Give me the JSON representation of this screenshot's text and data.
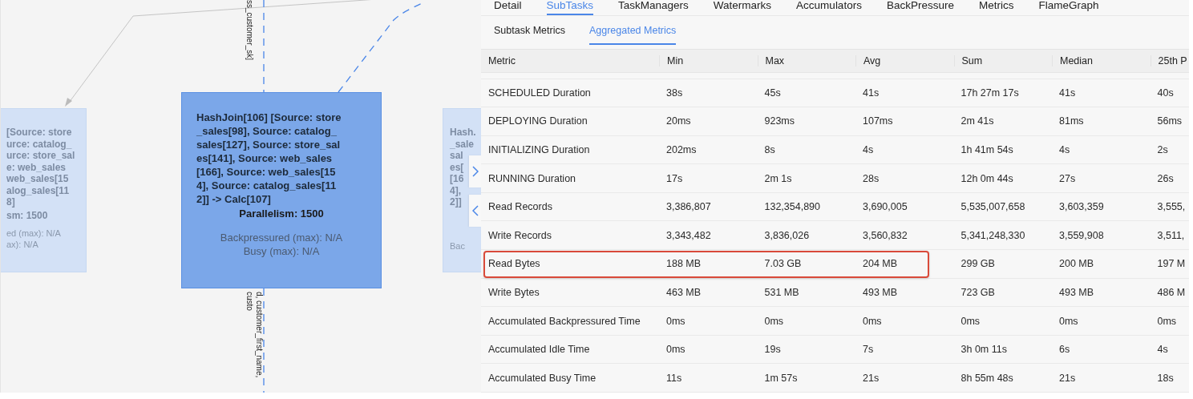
{
  "graph": {
    "edge_labels": [
      "ss_customer_sk]",
      "d, customer_first_name, custo"
    ],
    "nodes": [
      {
        "faded": true,
        "title_lines": [
          "[Source: store",
          "urce: catalog_",
          "urce: store_sal",
          "e: web_sales",
          "web_sales[15",
          "alog_sales[11",
          "8]"
        ],
        "parallelism": "sm: 1500",
        "metrics": [
          "ed (max): N/A",
          "ax): N/A"
        ]
      },
      {
        "faded": false,
        "title_lines": [
          "HashJoin[106] [Source: store",
          "_sales[98], Source: catalog_",
          "sales[127], Source: store_sal",
          "es[141], Source: web_sales",
          "[166], Source: web_sales[15",
          "4], Source: catalog_sales[11",
          "2]] -> Calc[107]"
        ],
        "parallelism": "Parallelism: 1500",
        "metrics": [
          "Backpressured (max): N/A",
          "Busy (max): N/A"
        ]
      },
      {
        "faded": true,
        "title_lines": [
          "Hash.",
          "_sale",
          "sal",
          "es[",
          "[16",
          "4],",
          "2]]"
        ],
        "metrics": [
          "Bac"
        ]
      }
    ]
  },
  "tabs": [
    {
      "label": "Detail",
      "selected": false
    },
    {
      "label": "SubTasks",
      "selected": true
    },
    {
      "label": "TaskManagers",
      "selected": false
    },
    {
      "label": "Watermarks",
      "selected": false
    },
    {
      "label": "Accumulators",
      "selected": false
    },
    {
      "label": "BackPressure",
      "selected": false
    },
    {
      "label": "Metrics",
      "selected": false
    },
    {
      "label": "FlameGraph",
      "selected": false
    }
  ],
  "subtabs": [
    {
      "label": "Subtask Metrics",
      "selected": false
    },
    {
      "label": "Aggregated Metrics",
      "selected": true
    }
  ],
  "table": {
    "columns": [
      "Metric",
      "Min",
      "Max",
      "Avg",
      "Sum",
      "Median",
      "25th P"
    ],
    "rows": [
      {
        "cells": [
          "SCHEDULED Duration",
          "38s",
          "45s",
          "41s",
          "17h 27m 17s",
          "41s",
          "40s"
        ],
        "highlighted": false
      },
      {
        "cells": [
          "DEPLOYING Duration",
          "20ms",
          "923ms",
          "107ms",
          "2m 41s",
          "81ms",
          "56ms"
        ],
        "highlighted": false
      },
      {
        "cells": [
          "INITIALIZING Duration",
          "202ms",
          "8s",
          "4s",
          "1h 41m 54s",
          "4s",
          "2s"
        ],
        "highlighted": false
      },
      {
        "cells": [
          "RUNNING Duration",
          "17s",
          "2m 1s",
          "28s",
          "12h 0m 44s",
          "27s",
          "26s"
        ],
        "highlighted": false
      },
      {
        "cells": [
          "Read Records",
          "3,386,807",
          "132,354,890",
          "3,690,005",
          "5,535,007,658",
          "3,603,359",
          "3,555,"
        ],
        "highlighted": false
      },
      {
        "cells": [
          "Write Records",
          "3,343,482",
          "3,836,026",
          "3,560,832",
          "5,341,248,330",
          "3,559,908",
          "3,511,"
        ],
        "highlighted": false
      },
      {
        "cells": [
          "Read Bytes",
          "188 MB",
          "7.03 GB",
          "204 MB",
          "299 GB",
          "200 MB",
          "197 M"
        ],
        "highlighted": true
      },
      {
        "cells": [
          "Write Bytes",
          "463 MB",
          "531 MB",
          "493 MB",
          "723 GB",
          "493 MB",
          "486 M"
        ],
        "highlighted": false
      },
      {
        "cells": [
          "Accumulated Backpressured Time",
          "0ms",
          "0ms",
          "0ms",
          "0ms",
          "0ms",
          "0ms"
        ],
        "highlighted": false
      },
      {
        "cells": [
          "Accumulated Idle Time",
          "0ms",
          "19s",
          "7s",
          "3h 0m 11s",
          "6s",
          "4s"
        ],
        "highlighted": false
      },
      {
        "cells": [
          "Accumulated Busy Time",
          "11s",
          "1m 57s",
          "21s",
          "8h 55m 48s",
          "21s",
          "18s"
        ],
        "highlighted": false
      }
    ]
  }
}
